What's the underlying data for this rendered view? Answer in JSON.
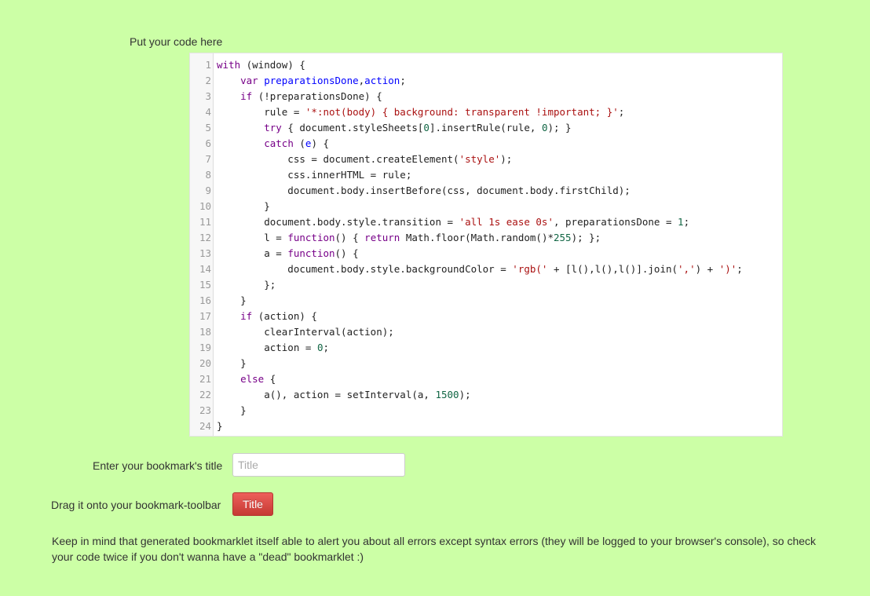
{
  "editor": {
    "label": "Put your code here",
    "lines": [
      {
        "n": "1",
        "t": [
          [
            "kw",
            "with"
          ],
          [
            "",
            " (window) {"
          ]
        ]
      },
      {
        "n": "2",
        "t": [
          [
            "",
            "    "
          ],
          [
            "kw",
            "var"
          ],
          [
            "",
            " "
          ],
          [
            "def",
            "preparationsDone"
          ],
          [
            "",
            ","
          ],
          [
            "def",
            "action"
          ],
          [
            "",
            ";"
          ]
        ]
      },
      {
        "n": "3",
        "t": [
          [
            "",
            "    "
          ],
          [
            "kw",
            "if"
          ],
          [
            "",
            " (!preparationsDone) {"
          ]
        ]
      },
      {
        "n": "4",
        "t": [
          [
            "",
            "        rule = "
          ],
          [
            "str",
            "'*:not(body) { background: transparent !important; }'"
          ],
          [
            "",
            ";"
          ]
        ]
      },
      {
        "n": "5",
        "t": [
          [
            "",
            "        "
          ],
          [
            "kw",
            "try"
          ],
          [
            "",
            " { document.styleSheets["
          ],
          [
            "num",
            "0"
          ],
          [
            "",
            "].insertRule(rule, "
          ],
          [
            "num",
            "0"
          ],
          [
            "",
            "); }"
          ]
        ]
      },
      {
        "n": "6",
        "t": [
          [
            "",
            "        "
          ],
          [
            "kw",
            "catch"
          ],
          [
            "",
            " ("
          ],
          [
            "def",
            "e"
          ],
          [
            "",
            ") {"
          ]
        ]
      },
      {
        "n": "7",
        "t": [
          [
            "",
            "            css = document.createElement("
          ],
          [
            "str",
            "'style'"
          ],
          [
            "",
            ");"
          ]
        ]
      },
      {
        "n": "8",
        "t": [
          [
            "",
            "            css.innerHTML = rule;"
          ]
        ]
      },
      {
        "n": "9",
        "t": [
          [
            "",
            "            document.body.insertBefore(css, document.body.firstChild);"
          ]
        ]
      },
      {
        "n": "10",
        "t": [
          [
            "",
            "        }"
          ]
        ]
      },
      {
        "n": "11",
        "t": [
          [
            "",
            "        document.body.style.transition = "
          ],
          [
            "str",
            "'all 1s ease 0s'"
          ],
          [
            "",
            ", preparationsDone = "
          ],
          [
            "num",
            "1"
          ],
          [
            "",
            ";"
          ]
        ]
      },
      {
        "n": "12",
        "t": [
          [
            "",
            "        l = "
          ],
          [
            "kw",
            "function"
          ],
          [
            "",
            "() { "
          ],
          [
            "kw",
            "return"
          ],
          [
            "",
            " Math.floor(Math.random()*"
          ],
          [
            "num",
            "255"
          ],
          [
            "",
            "); };"
          ]
        ]
      },
      {
        "n": "13",
        "t": [
          [
            "",
            "        a = "
          ],
          [
            "kw",
            "function"
          ],
          [
            "",
            "() {"
          ]
        ]
      },
      {
        "n": "14",
        "t": [
          [
            "",
            "            document.body.style.backgroundColor = "
          ],
          [
            "str",
            "'rgb('"
          ],
          [
            "",
            " + [l(),l(),l()].join("
          ],
          [
            "str",
            "','"
          ],
          [
            "",
            ") + "
          ],
          [
            "str",
            "')'"
          ],
          [
            "",
            ";"
          ]
        ]
      },
      {
        "n": "15",
        "t": [
          [
            "",
            "        };"
          ]
        ]
      },
      {
        "n": "16",
        "t": [
          [
            "",
            "    }"
          ]
        ]
      },
      {
        "n": "17",
        "t": [
          [
            "",
            "    "
          ],
          [
            "kw",
            "if"
          ],
          [
            "",
            " (action) {"
          ]
        ]
      },
      {
        "n": "18",
        "t": [
          [
            "",
            "        clearInterval(action);"
          ]
        ]
      },
      {
        "n": "19",
        "t": [
          [
            "",
            "        action = "
          ],
          [
            "num",
            "0"
          ],
          [
            "",
            ";"
          ]
        ]
      },
      {
        "n": "20",
        "t": [
          [
            "",
            "    }"
          ]
        ]
      },
      {
        "n": "21",
        "t": [
          [
            "",
            "    "
          ],
          [
            "kw",
            "else"
          ],
          [
            "",
            " {"
          ]
        ]
      },
      {
        "n": "22",
        "t": [
          [
            "",
            "        a(), action = setInterval(a, "
          ],
          [
            "num",
            "1500"
          ],
          [
            "",
            ");"
          ]
        ]
      },
      {
        "n": "23",
        "t": [
          [
            "",
            "    }"
          ]
        ]
      },
      {
        "n": "24",
        "t": [
          [
            "",
            "}"
          ]
        ]
      }
    ]
  },
  "title_row": {
    "label": "Enter your bookmark's title",
    "value": "",
    "placeholder": "Title"
  },
  "drag_row": {
    "label": "Drag it onto your bookmark-toolbar",
    "button_label": "Title"
  },
  "note": "Keep in mind that generated bookmarklet itself able to alert you about all errors except syntax errors (they will be logged to your browser's console), so check your code twice if you don't wanna have a \"dead\" bookmarklet :)",
  "colors": {
    "background": "#ccffa6",
    "keyword": "#770088",
    "definition": "#0000ff",
    "string": "#aa1111",
    "number": "#116644",
    "button": "#d9534f"
  }
}
